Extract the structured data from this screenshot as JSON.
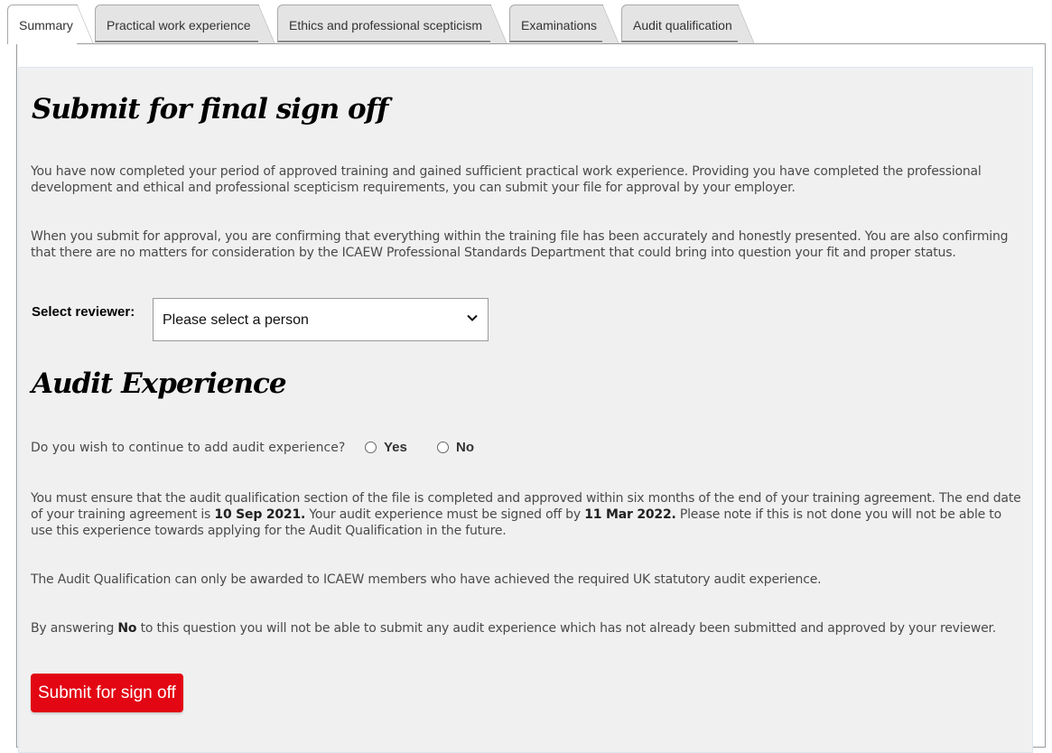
{
  "tabs": [
    {
      "label": "Summary",
      "active": true
    },
    {
      "label": "Practical work experience",
      "active": false
    },
    {
      "label": "Ethics and professional scepticism",
      "active": false
    },
    {
      "label": "Examinations",
      "active": false
    },
    {
      "label": "Audit qualification",
      "active": false
    }
  ],
  "submit_section": {
    "title": "Submit for final sign off",
    "para1": "You have now completed your period of approved training and gained sufficient practical work experience. Providing you have completed the professional development and ethical and professional scepticism requirements, you can submit your file for approval by your employer.",
    "para2": "When you submit for approval, you are confirming that everything within the training file has been accurately and honestly presented. You are also confirming that there are no matters for consideration by the ICAEW Professional Standards Department that could bring into question your fit and proper status.",
    "reviewer_label": "Select reviewer:",
    "reviewer_select_value": "Please select a person"
  },
  "audit_section": {
    "title": "Audit Experience",
    "question": "Do you wish to continue to add audit experience?",
    "option_yes": "Yes",
    "option_no": "No",
    "para1_a": "You must ensure that the audit qualification section of the file is completed and approved within six months of the end of your training agreement. The end date of your training agreement is ",
    "end_date": "10 Sep 2021.",
    "para1_b": " Your audit experience must be signed off by ",
    "signoff_date": "11 Mar 2022.",
    "para1_c": " Please note if this is not done you will not be able to use this experience towards applying for the Audit Qualification in the future.",
    "para2": "The Audit Qualification can only be awarded to ICAEW members who have achieved the required UK statutory audit experience.",
    "para3_a": "By answering ",
    "para3_bold": "No",
    "para3_b": " to this question you will not be able to submit any audit experience which has not already been submitted and approved by your reviewer."
  },
  "submit_button": {
    "label": "Submit for sign off",
    "color": "#e30613"
  }
}
